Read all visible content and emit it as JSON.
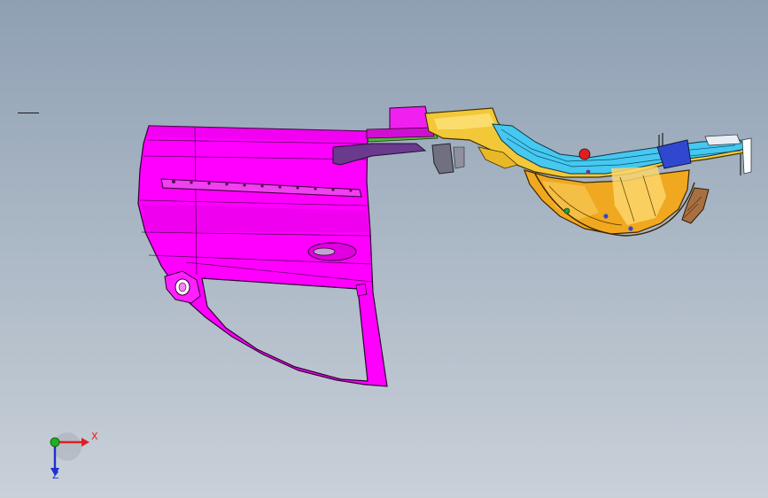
{
  "viewport": {
    "background_top": "#8fa0b4",
    "background_bottom": "#c9d0d8"
  },
  "model": {
    "parts": [
      {
        "name": "door-panel",
        "color": "#ff00ff"
      },
      {
        "name": "rocker-rail",
        "color": "#e8c040"
      },
      {
        "name": "rail-inner",
        "color": "#40c8f0"
      },
      {
        "name": "wheelhouse",
        "color": "#f0a820"
      },
      {
        "name": "bracket",
        "color": "#604080"
      }
    ]
  },
  "triad": {
    "x_label": "X",
    "z_label": "Z",
    "x_color": "#e02020",
    "y_color": "#20b020",
    "z_color": "#2030d0"
  }
}
